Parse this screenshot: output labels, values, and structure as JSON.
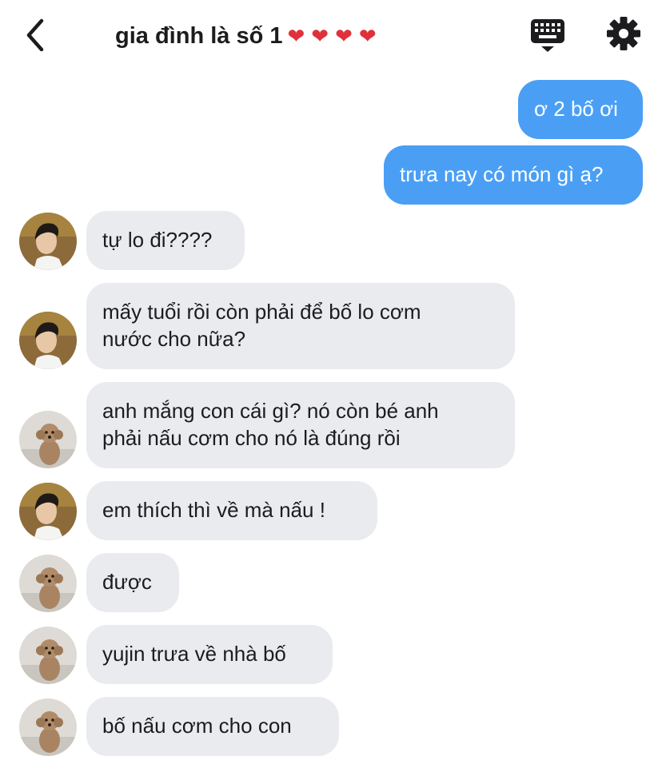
{
  "header": {
    "back_icon": "chevron-left-icon",
    "title": "gia đình là số 1",
    "hearts": "❤❤❤❤",
    "keyboard_icon": "keyboard-icon",
    "settings_icon": "gear-icon"
  },
  "colors": {
    "outgoing_bubble": "#4a9ff5",
    "incoming_bubble": "#e9ebef",
    "heart": "#e0303a"
  },
  "messages": [
    {
      "side": "out",
      "text": "ơ 2 bố ơi"
    },
    {
      "side": "out",
      "text": "trưa nay có món gì ạ?"
    },
    {
      "side": "in",
      "sender": "boy",
      "text": "tự lo đi????"
    },
    {
      "side": "in",
      "sender": "boy",
      "text": "mấy tuổi rồi còn phải để bố lo cơm\nnước cho nữa?"
    },
    {
      "side": "in",
      "sender": "dog",
      "text": "anh mắng con cái gì? nó còn bé anh\nphải nấu cơm cho nó là đúng rồi"
    },
    {
      "side": "in",
      "sender": "boy",
      "text": "em thích thì về mà nấu !"
    },
    {
      "side": "in",
      "sender": "dog",
      "text": "được"
    },
    {
      "side": "in",
      "sender": "dog",
      "text": "yujin trưa về nhà bố"
    },
    {
      "side": "in",
      "sender": "dog",
      "text": "bố nấu cơm cho con"
    }
  ]
}
